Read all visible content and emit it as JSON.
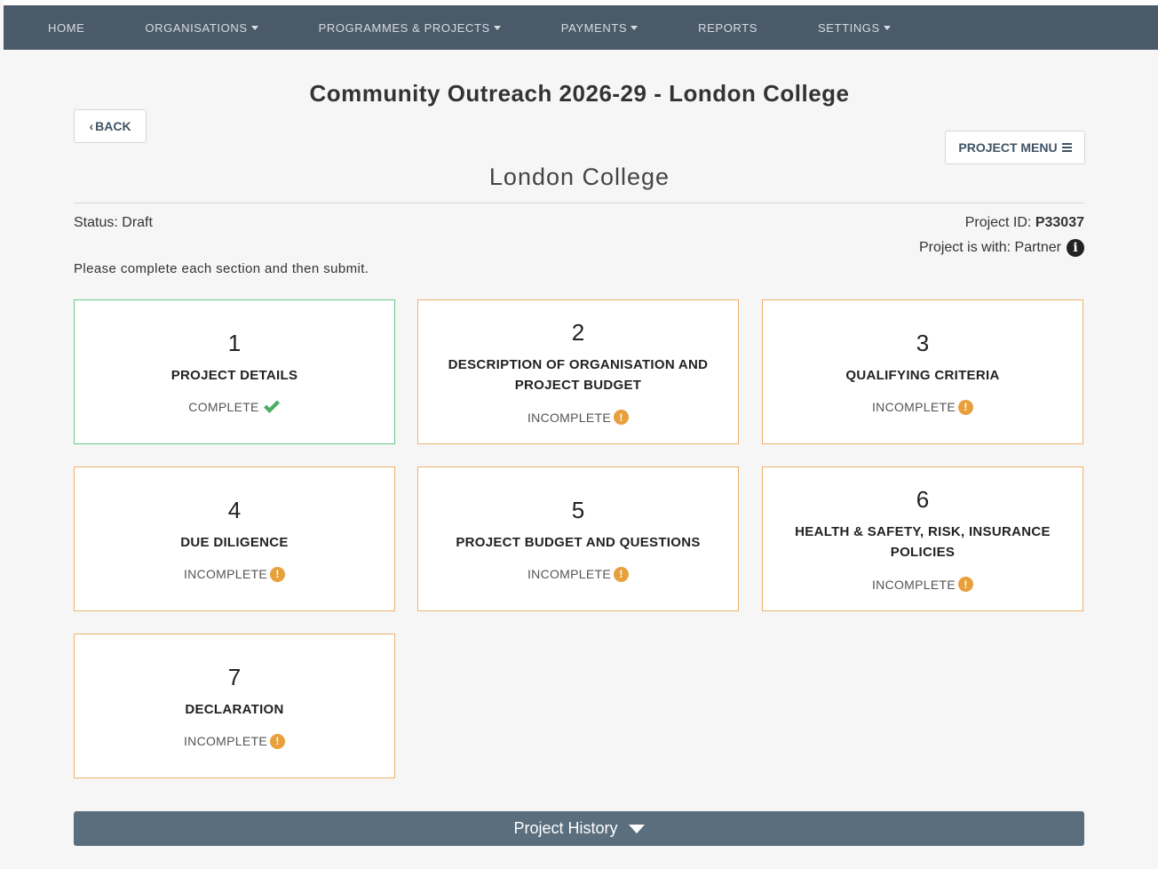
{
  "nav": {
    "items": [
      {
        "label": "HOME",
        "dropdown": false
      },
      {
        "label": "ORGANISATIONS",
        "dropdown": true
      },
      {
        "label": "PROGRAMMES & PROJECTS",
        "dropdown": true
      },
      {
        "label": "PAYMENTS",
        "dropdown": true
      },
      {
        "label": "REPORTS",
        "dropdown": false
      },
      {
        "label": "SETTINGS",
        "dropdown": true
      }
    ]
  },
  "header": {
    "back_label": "BACK",
    "title": "Community Outreach 2026-29 - London College",
    "subtitle": "London College",
    "menu_label": "PROJECT MENU"
  },
  "status": {
    "label": "Status:",
    "value": "Draft",
    "project_id_label": "Project ID:",
    "project_id": "P33037",
    "with_label": "Project is with:",
    "with_value": "Partner"
  },
  "instructions": "Please complete each section and then submit.",
  "sections": [
    {
      "number": "1",
      "name": "PROJECT DETAILS",
      "state": "COMPLETE",
      "complete": true
    },
    {
      "number": "2",
      "name": "DESCRIPTION OF ORGANISATION AND PROJECT BUDGET",
      "state": "INCOMPLETE",
      "complete": false
    },
    {
      "number": "3",
      "name": "QUALIFYING CRITERIA",
      "state": "INCOMPLETE",
      "complete": false
    },
    {
      "number": "4",
      "name": "DUE DILIGENCE",
      "state": "INCOMPLETE",
      "complete": false
    },
    {
      "number": "5",
      "name": "PROJECT BUDGET AND QUESTIONS",
      "state": "INCOMPLETE",
      "complete": false
    },
    {
      "number": "6",
      "name": "HEALTH & SAFETY, RISK, INSURANCE POLICIES",
      "state": "INCOMPLETE",
      "complete": false
    },
    {
      "number": "7",
      "name": "DECLARATION",
      "state": "INCOMPLETE",
      "complete": false
    }
  ],
  "history": {
    "label": "Project History"
  },
  "colors": {
    "nav_bg": "#4a5a68",
    "complete": "#4caf64",
    "incomplete": "#e8a03c"
  }
}
